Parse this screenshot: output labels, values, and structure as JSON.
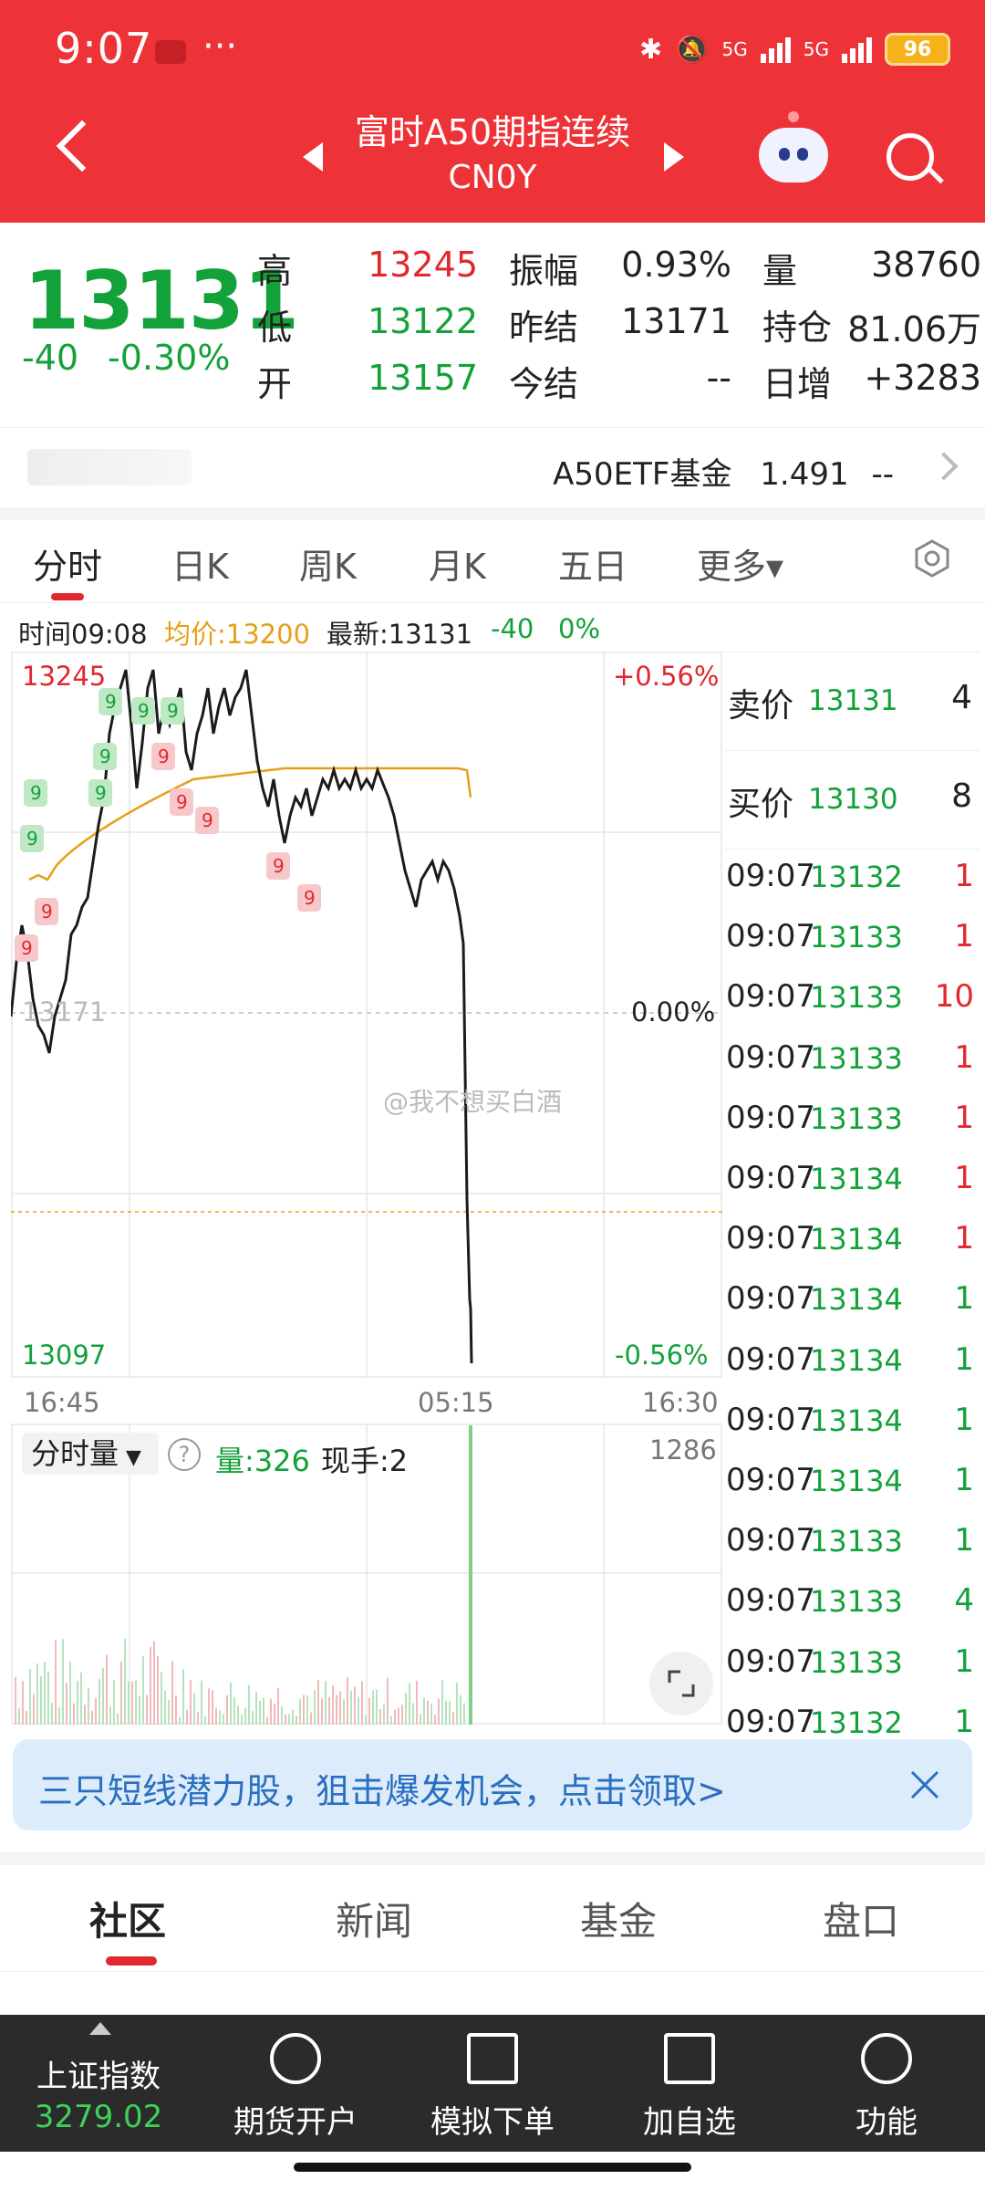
{
  "status": {
    "time": "9:07",
    "more": "···",
    "battery": "96",
    "net1": "5G",
    "net2": "5G"
  },
  "header": {
    "title": "富时A50期指连续",
    "code": "CN0Y"
  },
  "quote": {
    "last": "13131",
    "change": "-40",
    "change_pct": "-0.30%",
    "labels": {
      "high": "高",
      "low": "低",
      "open": "开",
      "amplitude": "振幅",
      "prev_settle": "昨结",
      "today_settle": "今结",
      "volume": "量",
      "open_interest": "持仓",
      "daily_increase": "日增"
    },
    "high": "13245",
    "low": "13122",
    "open": "13157",
    "amplitude": "0.93%",
    "prev_settle": "13171",
    "today_settle": "--",
    "volume": "38760",
    "open_interest": "81.06万",
    "daily_increase": "+3283"
  },
  "etf": {
    "name": "A50ETF基金",
    "price": "1.491",
    "change": "--"
  },
  "tabs": [
    "分时",
    "日K",
    "周K",
    "月K",
    "五日",
    "更多▾"
  ],
  "info": {
    "time": "时间09:08",
    "avg": "均价:13200",
    "latest": "最新:13131",
    "chg": "-40",
    "pct": "0%"
  },
  "chart_axes": {
    "y_top": "13245",
    "y_mid": "13171",
    "y_bottom": "13097",
    "pct_top": "+0.56%",
    "pct_mid": "0.00%",
    "pct_bottom": "-0.56%",
    "x_labels": [
      "16:45",
      "05:15",
      "16:30"
    ],
    "marker": "9",
    "watermark": "@我不想买白酒"
  },
  "orderbook": {
    "ask_label": "卖价",
    "ask_price": "13131",
    "ask_qty": "4",
    "bid_label": "买价",
    "bid_price": "13130",
    "bid_qty": "8"
  },
  "ticks": [
    {
      "time": "09:07",
      "price": "13132",
      "qty": "1",
      "dir": "red"
    },
    {
      "time": "09:07",
      "price": "13133",
      "qty": "1",
      "dir": "red"
    },
    {
      "time": "09:07",
      "price": "13133",
      "qty": "10",
      "dir": "red"
    },
    {
      "time": "09:07",
      "price": "13133",
      "qty": "1",
      "dir": "red"
    },
    {
      "time": "09:07",
      "price": "13133",
      "qty": "1",
      "dir": "red"
    },
    {
      "time": "09:07",
      "price": "13134",
      "qty": "1",
      "dir": "red"
    },
    {
      "time": "09:07",
      "price": "13134",
      "qty": "1",
      "dir": "red"
    },
    {
      "time": "09:07",
      "price": "13134",
      "qty": "1",
      "dir": "green"
    },
    {
      "time": "09:07",
      "price": "13134",
      "qty": "1",
      "dir": "green"
    },
    {
      "time": "09:07",
      "price": "13134",
      "qty": "1",
      "dir": "green"
    },
    {
      "time": "09:07",
      "price": "13134",
      "qty": "1",
      "dir": "green"
    },
    {
      "time": "09:07",
      "price": "13133",
      "qty": "1",
      "dir": "green"
    },
    {
      "time": "09:07",
      "price": "13133",
      "qty": "4",
      "dir": "green"
    },
    {
      "time": "09:07",
      "price": "13133",
      "qty": "1",
      "dir": "green"
    },
    {
      "time": "09:07",
      "price": "13132",
      "qty": "1",
      "dir": "green"
    }
  ],
  "volume_panel": {
    "selector": "分时量",
    "help": "?",
    "volume": "量:326",
    "current": "现手:2",
    "max": "1286"
  },
  "banner": {
    "text": "三只短线潜力股，狙击爆发机会，点击领取>"
  },
  "bottom_tabs": [
    "社区",
    "新闻",
    "基金",
    "盘口"
  ],
  "bottom_bar": {
    "index_name": "上证指数",
    "index_value": "3279.02",
    "items": [
      "期货开户",
      "模拟下单",
      "加自选",
      "功能"
    ]
  },
  "colors": {
    "header": "#ee3338",
    "up": "#e0282e",
    "down": "#13a13a",
    "avg_line": "#e5a017"
  }
}
